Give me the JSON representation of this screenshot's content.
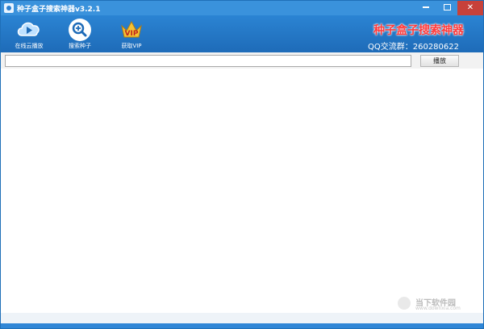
{
  "window": {
    "title": "种子盒子搜索神器v3.2.1"
  },
  "toolbar": {
    "items": [
      {
        "label": "在线云播放",
        "icon": "cloud-play-icon"
      },
      {
        "label": "搜索种子",
        "icon": "magnifier-icon"
      },
      {
        "label": "获取VIP",
        "icon": "vip-crown-icon"
      }
    ],
    "brand": "种子盒子搜索神器",
    "qq_group": "QQ交流群：260280622"
  },
  "address_bar": {
    "value": "",
    "placeholder": "",
    "play_label": "播放"
  },
  "watermark": {
    "text": "当下软件园",
    "url": "www.downxia.com"
  },
  "colors": {
    "titlebar": "#3a92dc",
    "toolbar": "#2b84d3",
    "brand_text": "#ff3b3b",
    "close_button": "#c7413a"
  }
}
